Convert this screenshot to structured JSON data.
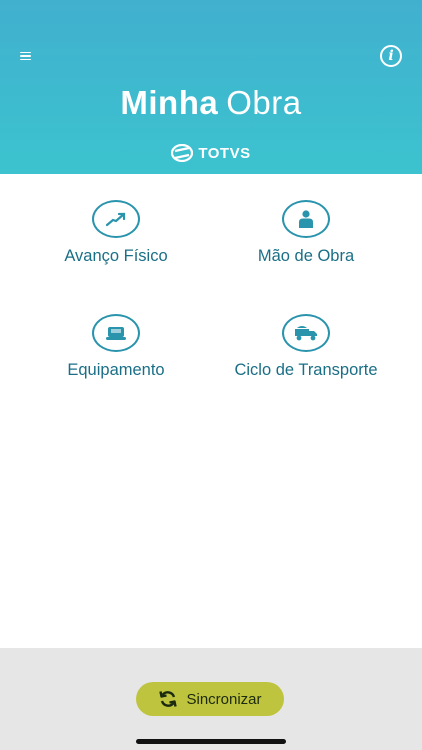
{
  "header": {
    "title_bold": "Minha",
    "title_light": "Obra",
    "brand": "TOTVS",
    "menu_icon": "hamburger-menu-icon",
    "info_icon": "info-icon",
    "info_glyph": "i"
  },
  "tiles": [
    {
      "label": "Avanço Físico",
      "icon": "trend-arrow-icon"
    },
    {
      "label": "Mão de Obra",
      "icon": "worker-icon"
    },
    {
      "label": "Equipamento",
      "icon": "machine-icon"
    },
    {
      "label": "Ciclo de Transporte",
      "icon": "dump-truck-icon"
    }
  ],
  "footer": {
    "sync_label": "Sincronizar",
    "sync_icon": "refresh-icon"
  },
  "colors": {
    "header_top": "#41b0cf",
    "header_bottom": "#3cc3cf",
    "accent": "#2a94ad",
    "sync_button": "#bec43e",
    "footer_bg": "#e6e6e6"
  }
}
